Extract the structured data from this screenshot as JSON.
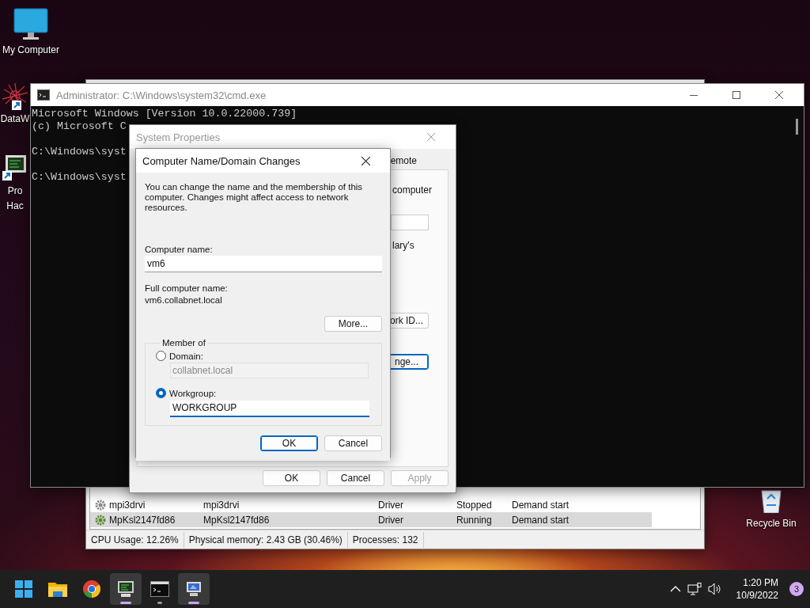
{
  "desktop_icons": [
    {
      "kind": "monitor",
      "lines": [
        "My Computer"
      ],
      "shortcut": false
    },
    {
      "kind": "starburst",
      "lines": [
        "DataW"
      ],
      "shortcut": true
    },
    {
      "kind": "terminal-pc",
      "lines": [
        "Pro",
        "Hac"
      ],
      "shortcut": true
    }
  ],
  "recycle_bin": {
    "label": "Recycle Bin"
  },
  "services": {
    "rows": [
      {
        "cells": [
          "mpi3drvi",
          "mpi3drvi",
          "Driver",
          "Stopped",
          "Demand start"
        ],
        "selected": false
      },
      {
        "cells": [
          "MpKsl2147fd86",
          "MpKsl2147fd86",
          "Driver",
          "Running",
          "Demand start"
        ],
        "selected": true
      }
    ],
    "status_bar": [
      "CPU Usage: 12.26%",
      "Physical memory: 2.43 GB (30.46%)",
      "Processes: 132"
    ]
  },
  "cmd": {
    "title": "Administrator: C:\\Windows\\system32\\cmd.exe",
    "blocks": [
      [
        "Microsoft Windows [Version 10.0.22000.739]",
        "(c) Microsoft C"
      ],
      [
        "C:\\Windows\\syst"
      ],
      [
        "C:\\Windows\\syst"
      ]
    ]
  },
  "system_properties": {
    "title": "System Properties",
    "tab": "emote",
    "text_1": "computer",
    "text_2": "lary's",
    "buttons": [
      {
        "label": "ork ID...",
        "focused": false
      },
      {
        "label": "nge...",
        "focused": true
      }
    ],
    "footer_buttons": [
      {
        "label": "OK",
        "disabled": false
      },
      {
        "label": "Cancel",
        "disabled": false
      },
      {
        "label": "Apply",
        "disabled": true
      }
    ]
  },
  "dialog": {
    "title": "Computer Name/Domain Changes",
    "description": "You can change the name and the membership of this computer. Changes might affect access to network resources.",
    "computer_name_label": "Computer name:",
    "computer_name": "vm6",
    "full_name_label": "Full computer name:",
    "full_name": "vm6.collabnet.local",
    "more_button": "More...",
    "member_of": "Member of",
    "member_options": [
      {
        "label": "Domain:",
        "selected": false,
        "value": "collabnet.local"
      },
      {
        "label": "Workgroup:",
        "selected": true,
        "value": "WORKGROUP"
      }
    ],
    "buttons": [
      {
        "label": "OK",
        "default": true
      },
      {
        "label": "Cancel",
        "default": false
      }
    ]
  },
  "taskbar": {
    "apps": [
      {
        "kind": "start",
        "running": false,
        "active": false
      },
      {
        "kind": "folder",
        "running": false,
        "active": false
      },
      {
        "kind": "browser",
        "running": false,
        "active": false
      },
      {
        "kind": "green-monitor",
        "running": true,
        "active": true
      },
      {
        "kind": "terminal",
        "running": true,
        "active": false
      },
      {
        "kind": "pc",
        "running": true,
        "active": true
      }
    ],
    "time": "1:20 PM",
    "date": "10/9/2022",
    "notifications": "3"
  }
}
